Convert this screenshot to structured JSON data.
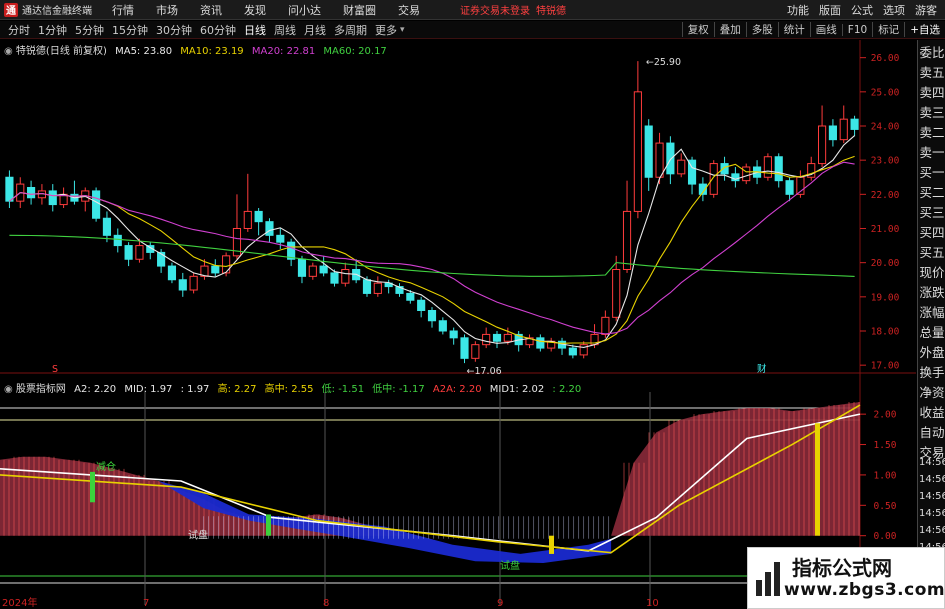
{
  "topbar": {
    "app_title": "通达信金融终端",
    "menus": [
      "行情",
      "市场",
      "资讯",
      "发现",
      "问小达",
      "财富圈",
      "交易"
    ],
    "warning": "证券交易未登录",
    "warning_name": "特锐德",
    "right_menus": [
      "功能",
      "版面",
      "公式",
      "选项"
    ],
    "guest": "游客"
  },
  "periods": [
    "分时",
    "1分钟",
    "5分钟",
    "15分钟",
    "30分钟",
    "60分钟",
    "日线",
    "周线",
    "月线",
    "多周期",
    "更多"
  ],
  "active_period": "日线",
  "tools": [
    "复权",
    "叠加",
    "多股",
    "统计",
    "画线",
    "F10",
    "标记",
    "+自选"
  ],
  "main_legend": {
    "name": "特锐德(日线 前复权)",
    "items": [
      {
        "label": "MA5: 23.80",
        "color": "#e8e8e8"
      },
      {
        "label": "MA10: 23.19",
        "color": "#e8d200"
      },
      {
        "label": "MA20: 22.81",
        "color": "#d040d0"
      },
      {
        "label": "MA60: 20.17",
        "color": "#40d040"
      }
    ]
  },
  "sub_legend": {
    "name": "股票指标网",
    "items": [
      {
        "label": "A2: 2.20",
        "color": "#e8e8e8"
      },
      {
        "label": "MID: 1.97",
        "color": "#e8e8e8"
      },
      {
        "label": ": 1.97",
        "color": "#e8e8e8"
      },
      {
        "label": "高: 2.27",
        "color": "#e8d200"
      },
      {
        "label": "高中: 2.55",
        "color": "#e8d200"
      },
      {
        "label": "低: -1.51",
        "color": "#40d040"
      },
      {
        "label": "低中: -1.17",
        "color": "#40d040"
      },
      {
        "label": "A2A: 2.20",
        "color": "#ff3c3c"
      },
      {
        "label": "MID1: 2.02",
        "color": "#e8e8e8"
      },
      {
        "label": ": 2.20",
        "color": "#40d040"
      }
    ]
  },
  "price_axis": [
    "26.00",
    "25.00",
    "24.00",
    "23.00",
    "22.00",
    "21.00",
    "20.00",
    "19.00",
    "18.00",
    "17.00"
  ],
  "sub_axis": [
    "2.00",
    "1.50",
    "1.00",
    "0.50",
    "0.00"
  ],
  "x_labels": [
    "2024年",
    "7",
    "8",
    "9",
    "10"
  ],
  "annotations": {
    "high": "25.90",
    "low": "17.06",
    "finance_mark": "财",
    "mark_s": "S"
  },
  "sub_labels": {
    "a": "减仓",
    "b": "试盘",
    "c": "试盘"
  },
  "side_panel": [
    "委比",
    "卖五",
    "卖四",
    "卖三",
    "卖二",
    "卖一",
    "买一",
    "买二",
    "买三",
    "买四",
    "买五",
    "现价",
    "涨跌",
    "涨幅",
    "总量",
    "外盘",
    "换手",
    "净资",
    "收益",
    "自动",
    "交易",
    "14:56",
    "14:56",
    "14:56",
    "14:56",
    "14:56",
    "14:56",
    "14:56",
    "14:56",
    "14:56"
  ],
  "watermark": {
    "title": "指标公式网",
    "url": "www.zbgs3.com"
  },
  "chart_data": {
    "type": "candlestick",
    "title": "特锐德(日线 前复权)",
    "ylim": [
      16.8,
      26.4
    ],
    "candles": [
      [
        22.5,
        21.8,
        22.7,
        21.6
      ],
      [
        21.8,
        22.3,
        22.5,
        21.6
      ],
      [
        22.2,
        21.9,
        22.4,
        21.7
      ],
      [
        21.9,
        22.1,
        22.3,
        21.7
      ],
      [
        22.1,
        21.7,
        22.3,
        21.5
      ],
      [
        21.7,
        22.0,
        22.2,
        21.6
      ],
      [
        22.0,
        21.8,
        22.4,
        21.7
      ],
      [
        21.8,
        22.1,
        22.2,
        21.5
      ],
      [
        22.1,
        21.3,
        22.2,
        21.2
      ],
      [
        21.3,
        20.8,
        21.5,
        20.6
      ],
      [
        20.8,
        20.5,
        21.0,
        20.3
      ],
      [
        20.5,
        20.1,
        20.6,
        19.9
      ],
      [
        20.1,
        20.5,
        20.7,
        20.0
      ],
      [
        20.5,
        20.3,
        20.6,
        20.1
      ],
      [
        20.3,
        19.9,
        20.4,
        19.7
      ],
      [
        19.9,
        19.5,
        20.0,
        19.4
      ],
      [
        19.5,
        19.2,
        19.7,
        19.0
      ],
      [
        19.2,
        19.6,
        19.7,
        19.1
      ],
      [
        19.6,
        19.9,
        20.1,
        19.5
      ],
      [
        19.9,
        19.7,
        20.1,
        19.6
      ],
      [
        19.7,
        20.2,
        20.3,
        19.6
      ],
      [
        20.2,
        21.0,
        22.0,
        20.1
      ],
      [
        21.0,
        21.5,
        22.6,
        20.9
      ],
      [
        21.5,
        21.2,
        21.6,
        20.8
      ],
      [
        21.2,
        20.8,
        21.3,
        20.6
      ],
      [
        20.8,
        20.6,
        21.0,
        20.4
      ],
      [
        20.6,
        20.1,
        20.7,
        19.9
      ],
      [
        20.1,
        19.6,
        20.2,
        19.4
      ],
      [
        19.6,
        19.9,
        20.0,
        19.5
      ],
      [
        19.9,
        19.7,
        20.2,
        19.6
      ],
      [
        19.7,
        19.4,
        19.8,
        19.3
      ],
      [
        19.4,
        19.8,
        20.0,
        19.3
      ],
      [
        19.8,
        19.5,
        20.1,
        19.4
      ],
      [
        19.5,
        19.1,
        19.6,
        19.0
      ],
      [
        19.1,
        19.4,
        19.6,
        19.0
      ],
      [
        19.4,
        19.3,
        19.5,
        19.1
      ],
      [
        19.3,
        19.1,
        19.4,
        19.0
      ],
      [
        19.1,
        18.9,
        19.2,
        18.8
      ],
      [
        18.9,
        18.6,
        19.0,
        18.4
      ],
      [
        18.6,
        18.3,
        18.7,
        18.1
      ],
      [
        18.3,
        18.0,
        18.4,
        17.9
      ],
      [
        18.0,
        17.8,
        18.1,
        17.6
      ],
      [
        17.8,
        17.2,
        17.9,
        17.06
      ],
      [
        17.2,
        17.6,
        17.7,
        17.1
      ],
      [
        17.6,
        17.9,
        18.1,
        17.5
      ],
      [
        17.9,
        17.7,
        18.0,
        17.5
      ],
      [
        17.7,
        17.9,
        18.1,
        17.6
      ],
      [
        17.9,
        17.6,
        18.0,
        17.4
      ],
      [
        17.6,
        17.8,
        17.9,
        17.5
      ],
      [
        17.8,
        17.5,
        17.9,
        17.4
      ],
      [
        17.5,
        17.7,
        17.8,
        17.4
      ],
      [
        17.7,
        17.5,
        17.8,
        17.3
      ],
      [
        17.5,
        17.3,
        17.6,
        17.2
      ],
      [
        17.3,
        17.6,
        17.7,
        17.2
      ],
      [
        17.6,
        17.9,
        18.2,
        17.5
      ],
      [
        17.9,
        18.4,
        18.6,
        17.8
      ],
      [
        18.4,
        19.8,
        20.2,
        18.3
      ],
      [
        19.8,
        21.5,
        22.4,
        19.7
      ],
      [
        21.5,
        25.0,
        25.9,
        21.3
      ],
      [
        24.0,
        22.5,
        24.2,
        22.1
      ],
      [
        22.5,
        23.5,
        23.8,
        22.3
      ],
      [
        23.5,
        22.6,
        23.7,
        22.3
      ],
      [
        22.6,
        23.0,
        23.2,
        22.5
      ],
      [
        23.0,
        22.3,
        23.1,
        22.0
      ],
      [
        22.3,
        22.0,
        22.5,
        21.8
      ],
      [
        22.0,
        22.9,
        23.0,
        21.9
      ],
      [
        22.9,
        22.6,
        23.1,
        22.4
      ],
      [
        22.6,
        22.4,
        22.8,
        22.2
      ],
      [
        22.4,
        22.8,
        22.9,
        22.3
      ],
      [
        22.8,
        22.5,
        23.0,
        22.3
      ],
      [
        22.5,
        23.1,
        23.2,
        22.4
      ],
      [
        23.1,
        22.4,
        23.2,
        22.2
      ],
      [
        22.4,
        22.0,
        22.5,
        21.8
      ],
      [
        22.0,
        22.5,
        22.7,
        21.9
      ],
      [
        22.5,
        22.9,
        23.1,
        22.4
      ],
      [
        22.9,
        24.0,
        24.6,
        22.8
      ],
      [
        24.0,
        23.6,
        24.2,
        23.4
      ],
      [
        23.6,
        24.2,
        24.6,
        23.5
      ],
      [
        24.2,
        23.9,
        24.3,
        23.7
      ]
    ],
    "ma5_end": 23.8,
    "ma10_end": 23.19,
    "ma20_end": 22.81,
    "ma60_end": 20.17
  }
}
